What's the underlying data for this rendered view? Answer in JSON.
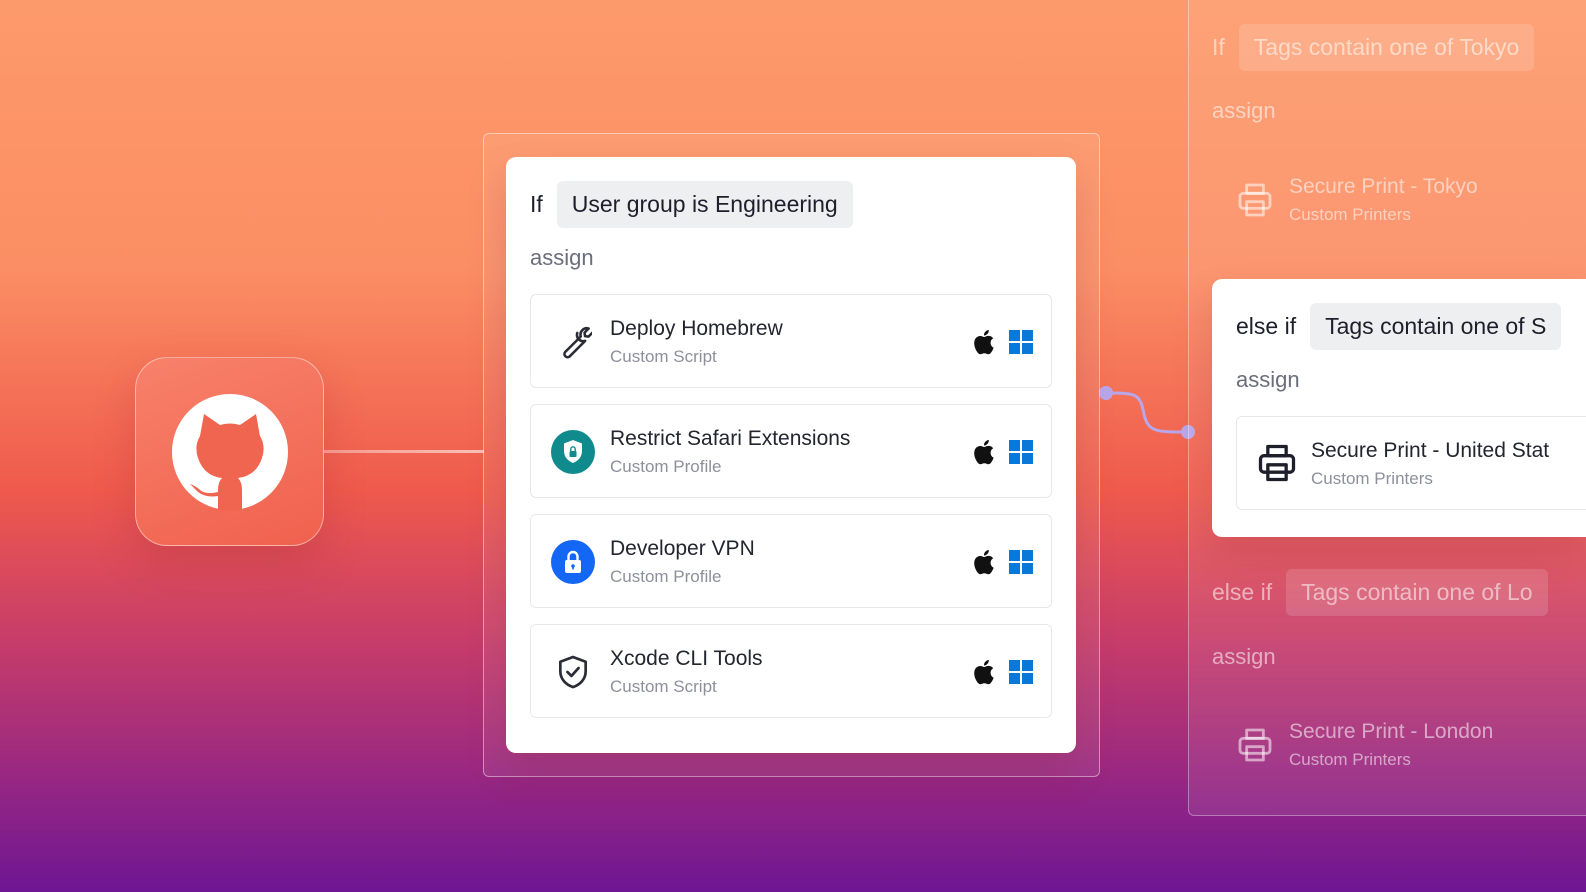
{
  "center": {
    "if_label": "If",
    "condition": "User group is Engineering",
    "assign_label": "assign",
    "items": [
      {
        "title": "Deploy Homebrew",
        "subtitle": "Custom Script",
        "icon": "wrench-icon"
      },
      {
        "title": "Restrict Safari Extensions",
        "subtitle": "Custom Profile",
        "icon": "safari-shield-icon"
      },
      {
        "title": "Developer VPN",
        "subtitle": "Custom Profile",
        "icon": "lock-icon"
      },
      {
        "title": "Xcode CLI Tools",
        "subtitle": "Custom Script",
        "icon": "shield-check-icon"
      }
    ]
  },
  "right": {
    "top_rule": {
      "if_label": "If",
      "condition": "Tags contain one of Tokyo",
      "assign_label": "assign",
      "item": {
        "title": "Secure Print - Tokyo",
        "subtitle": "Custom Printers"
      }
    },
    "middle_rule": {
      "if_label": "else if",
      "condition": "Tags contain one of S",
      "assign_label": "assign",
      "item": {
        "title": "Secure Print - United Stat",
        "subtitle": "Custom Printers"
      }
    },
    "bottom_rule": {
      "if_label": "else if",
      "condition": "Tags contain one of Lo",
      "assign_label": "assign",
      "item": {
        "title": "Secure Print - London",
        "subtitle": "Custom Printers"
      }
    }
  },
  "colors": {
    "apple": "#111111",
    "windows": "#0a78d7",
    "safari_badge": "#0f8b8d",
    "vpn_badge": "#1466f5",
    "connector": "#b9a6ea"
  }
}
